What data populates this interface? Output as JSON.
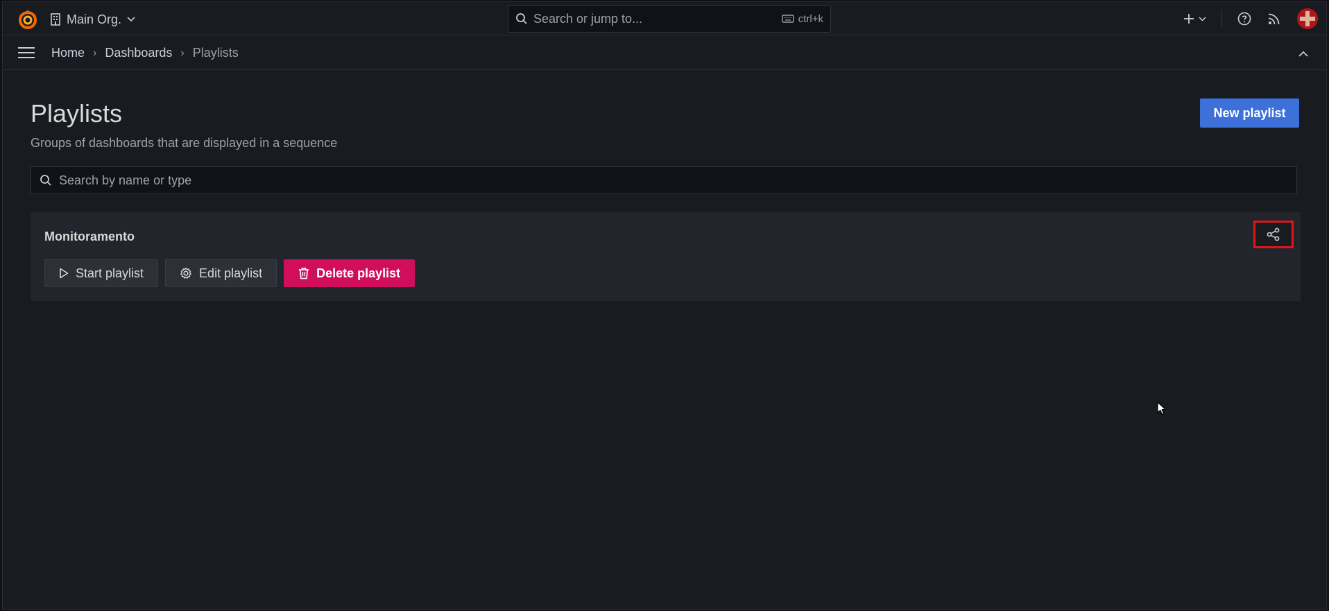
{
  "topbar": {
    "org_name": "Main Org.",
    "search_placeholder": "Search or jump to...",
    "search_shortcut": "ctrl+k"
  },
  "breadcrumb": {
    "home": "Home",
    "dashboards": "Dashboards",
    "current": "Playlists"
  },
  "page": {
    "title": "Playlists",
    "subtitle": "Groups of dashboards that are displayed in a sequence",
    "new_button": "New playlist",
    "search_placeholder": "Search by name or type"
  },
  "playlists": [
    {
      "name": "Monitoramento",
      "start_label": "Start playlist",
      "edit_label": "Edit playlist",
      "delete_label": "Delete playlist"
    }
  ],
  "colors": {
    "primary": "#3d71d9",
    "danger": "#d10e5c",
    "highlight": "#e0161b",
    "background": "#181b1f"
  },
  "icons": {
    "logo": "grafana-logo",
    "org": "building-icon",
    "search": "search-icon",
    "keyboard": "keyboard-icon",
    "add": "plus-icon",
    "help": "help-icon",
    "news": "rss-icon",
    "menu": "hamburger-icon",
    "collapse": "chevron-up-icon",
    "start": "play-icon",
    "edit": "gear-icon",
    "delete": "trash-icon",
    "share": "share-icon"
  }
}
